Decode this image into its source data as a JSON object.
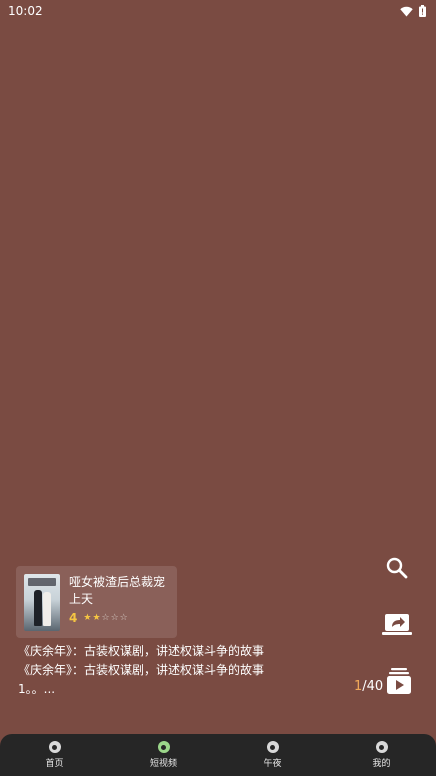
{
  "status_bar": {
    "time": "10:02"
  },
  "drama_card": {
    "title": "哑女被渣后总裁宠上天",
    "score": "4",
    "stars_filled": 2,
    "stars_total": 5
  },
  "description": {
    "line1": "《庆余年》：古装权谋剧，讲述权谋斗争的故事",
    "line2": "《庆余年》：古装权谋剧，讲述权谋斗争的故事",
    "line3": "1。。..."
  },
  "episode_counter": {
    "current": "1",
    "total": "/40"
  },
  "side_actions": {
    "search": "search-icon",
    "share": "share-icon",
    "episodes": "episode-list-icon"
  },
  "tabs": [
    {
      "label": "首页",
      "active": false
    },
    {
      "label": "短视频",
      "active": true
    },
    {
      "label": "午夜",
      "active": false
    },
    {
      "label": "我的",
      "active": false
    }
  ],
  "colors": {
    "background": "#7a4b42",
    "tabbar": "#262626",
    "accent": "#f0a95a",
    "star": "#f5c542"
  }
}
